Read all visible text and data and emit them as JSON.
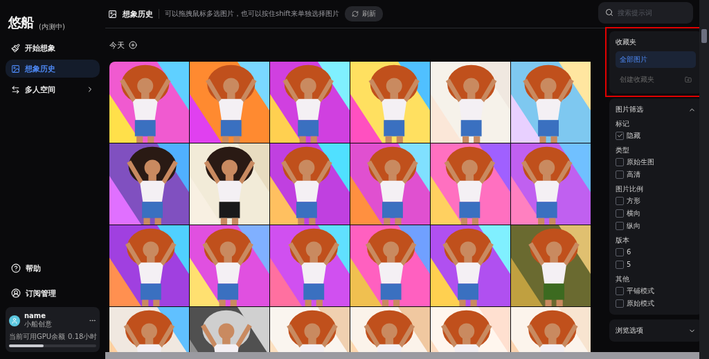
{
  "sidebar": {
    "logo": "悠船",
    "badge": "(内测中)",
    "items": [
      {
        "label": "开始想象",
        "selected": false,
        "has_submenu": false
      },
      {
        "label": "想象历史",
        "selected": true,
        "has_submenu": false
      },
      {
        "label": "多人空间",
        "selected": false,
        "has_submenu": true
      }
    ],
    "bottom_items": [
      {
        "label": "帮助"
      },
      {
        "label": "订阅管理"
      }
    ],
    "account": {
      "name": "name",
      "plan": "小船创意",
      "quota_label": "当前可用GPU余额",
      "quota_value": "0.18小时",
      "level": 0.4
    }
  },
  "header": {
    "title": "想象历史",
    "hint": "可以拖拽鼠标多选图片，也可以按住shift来单独选择图片",
    "refresh": "刷新"
  },
  "search": {
    "placeholder": "搜索提示词"
  },
  "gallery": {
    "section": "今天"
  },
  "favorites": {
    "title": "收藏夹",
    "highlighted": true,
    "items": [
      {
        "label": "全部图片",
        "selected": true
      },
      {
        "label": "创建收藏夹",
        "selected": false
      }
    ]
  },
  "filters": {
    "title": "图片筛选",
    "expanded": true,
    "groups": [
      {
        "title": "标记",
        "options": [
          {
            "label": "隐藏",
            "checked": true
          }
        ]
      },
      {
        "title": "类型",
        "options": [
          {
            "label": "原始生图",
            "checked": false
          },
          {
            "label": "高清",
            "checked": false
          }
        ]
      },
      {
        "title": "图片比例",
        "options": [
          {
            "label": "方形",
            "checked": false
          },
          {
            "label": "横向",
            "checked": false
          },
          {
            "label": "纵向",
            "checked": false
          }
        ]
      },
      {
        "title": "版本",
        "options": [
          {
            "label": "6",
            "checked": false
          },
          {
            "label": "5",
            "checked": false
          }
        ]
      },
      {
        "title": "其他",
        "options": [
          {
            "label": "平铺模式",
            "checked": false
          },
          {
            "label": "原始模式",
            "checked": false
          }
        ]
      }
    ]
  },
  "browse": {
    "title": "浏览选项",
    "expanded": false
  }
}
